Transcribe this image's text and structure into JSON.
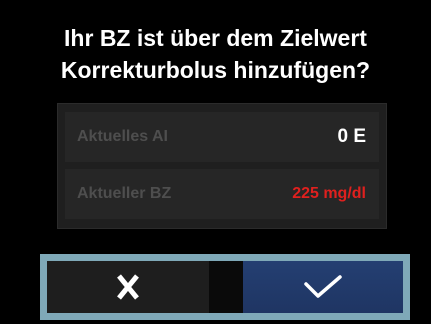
{
  "dialog": {
    "title_line1": "Ihr BZ ist über dem Zielwert",
    "title_line2": "Korrekturbolus hinzufügen?"
  },
  "info": {
    "rows": [
      {
        "label": "Aktuelles AI",
        "value": "0 E"
      },
      {
        "label": "Aktueller BZ",
        "value": "225 mg/dl"
      }
    ]
  },
  "buttons": {
    "cancel_icon": "x-icon",
    "confirm_icon": "checkmark-icon"
  },
  "colors": {
    "background": "#000000",
    "title_text": "#ffffff",
    "label_text": "#4e4e4e",
    "value_text": "#ffffff",
    "warning_value": "#e0201e",
    "button_frame": "#7fa9b8",
    "confirm_button": "#243f72",
    "cancel_button": "#1e1e1e"
  }
}
